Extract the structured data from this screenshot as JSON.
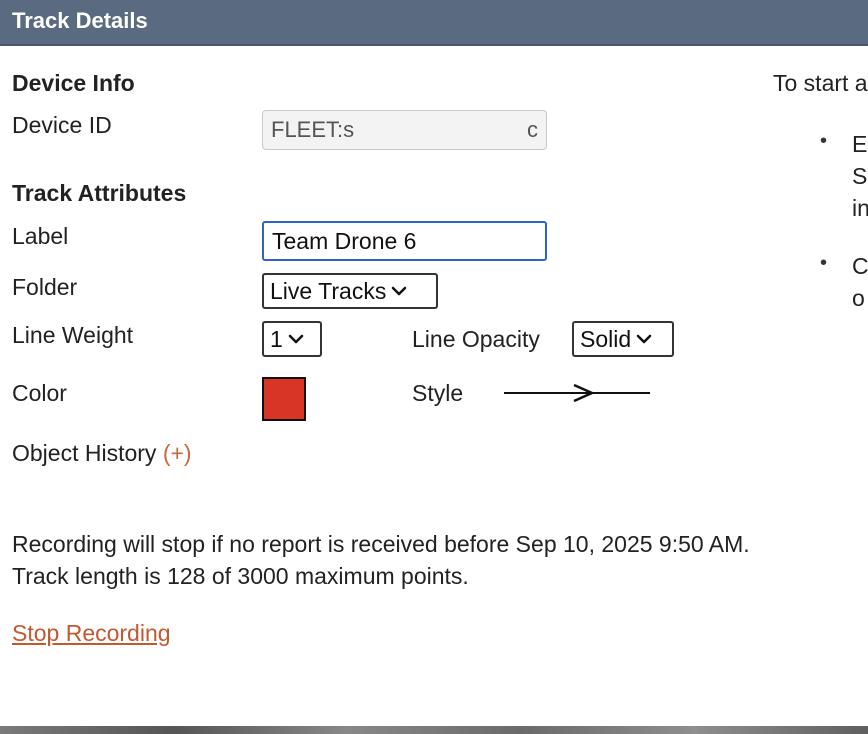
{
  "panel": {
    "title": "Track Details"
  },
  "device_info": {
    "heading": "Device Info",
    "device_id_label": "Device ID",
    "device_id_value": "FLEET:s",
    "device_id_tail": "c"
  },
  "track_attributes": {
    "heading": "Track Attributes",
    "label_label": "Label",
    "label_value": "Team Drone 6",
    "folder_label": "Folder",
    "folder_value": "Live Tracks",
    "line_weight_label": "Line Weight",
    "line_weight_value": "1",
    "line_opacity_label": "Line Opacity",
    "line_opacity_value": "Solid",
    "color_label": "Color",
    "color_value": "#d93526",
    "style_label": "Style",
    "object_history_label": "Object History",
    "object_history_toggle": "(+)"
  },
  "status": {
    "line1": "Recording will stop if no report is received before Sep 10, 2025 9:50 AM.",
    "line2": "Track length is 128 of 3000 maximum points.",
    "stop_link": "Stop Recording"
  },
  "side_help": {
    "intro": "To start a",
    "bullet1_lines": [
      "E",
      "S",
      "in"
    ],
    "bullet2_lines": [
      "C",
      "o"
    ]
  },
  "icons": {
    "chevron": "chevron-down-icon",
    "arrow": "arrow-line-icon"
  }
}
